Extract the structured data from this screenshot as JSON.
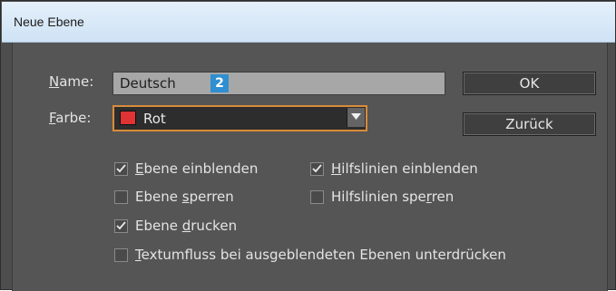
{
  "window": {
    "title": "Neue Ebene"
  },
  "form": {
    "name_label_mnemonic": "N",
    "name_label_rest": "ame:",
    "name_value": "Deutsch",
    "color_label_mnemonic": "F",
    "color_label_rest": "arbe:",
    "color_value": "Rot",
    "color_swatch": "#e03333"
  },
  "buttons": {
    "ok": "OK",
    "back": "Zurück"
  },
  "options": {
    "show_layer": {
      "pre": "",
      "mn": "E",
      "post": "bene einblenden",
      "checked": true
    },
    "show_guides": {
      "pre": "",
      "mn": "H",
      "post": "ilfslinien einblenden",
      "checked": true
    },
    "lock_layer": {
      "pre": "Ebene ",
      "mn": "s",
      "post": "perren",
      "checked": false
    },
    "lock_guides": {
      "pre": "Hilfslinien spe",
      "mn": "r",
      "post": "ren",
      "checked": false
    },
    "print_layer": {
      "pre": "Ebene ",
      "mn": "d",
      "post": "rucken",
      "checked": true
    },
    "suppress_wrap": {
      "pre": "",
      "mn": "T",
      "post": "extumfluss bei ausgeblendeten Ebenen unterdrücken",
      "checked": false
    }
  },
  "badge": "2",
  "colors": {
    "accent": "#d98c3a",
    "badge": "#2f8fd0",
    "dialog_bg": "#555555"
  }
}
